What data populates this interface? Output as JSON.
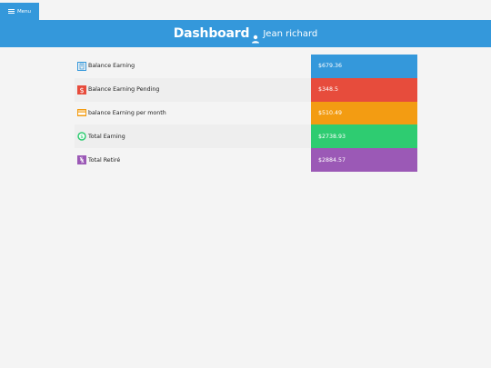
{
  "menu": {
    "label": "Menu"
  },
  "header": {
    "title": "Dashboard",
    "user_name": "Jean richard"
  },
  "rows": [
    {
      "label": "Balance Earning",
      "value": "$679.36",
      "color": "#3498db",
      "icon": "building-icon",
      "icon_color": "#3498db"
    },
    {
      "label": "Balance Earning Pending",
      "value": "$348.5",
      "color": "#e74c3c",
      "icon": "dollar-icon",
      "icon_color": "#e74c3c"
    },
    {
      "label": "balance Earning per month",
      "value": "$510.49",
      "color": "#f39c12",
      "icon": "credit-card-icon",
      "icon_color": "#f39c12"
    },
    {
      "label": "Total Earning",
      "value": "$2738.93",
      "color": "#2ecc71",
      "icon": "money-circle-icon",
      "icon_color": "#2ecc71"
    },
    {
      "label": "Total Retiré",
      "value": "$2884.57",
      "color": "#9b59b6",
      "icon": "withdraw-icon",
      "icon_color": "#9b59b6"
    }
  ]
}
